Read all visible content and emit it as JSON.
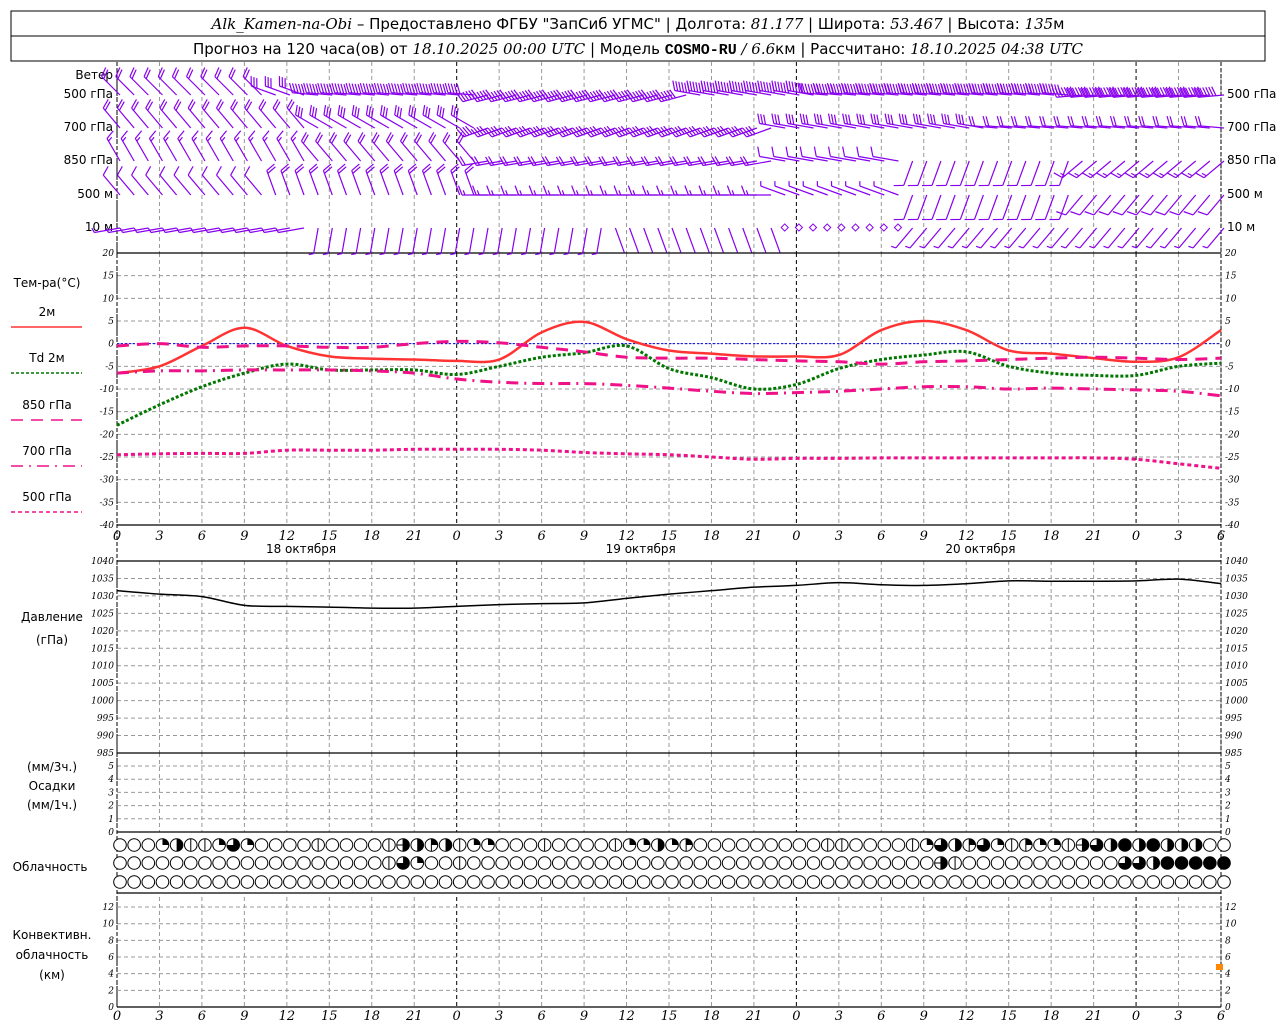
{
  "header": {
    "station": "Alk_Kamen-na-Obi",
    "provider": " – Предоставлено ФГБУ \"ЗапСиб УГМС\" | Долгота: ",
    "lon": "81.177",
    "lat_label": " | Широта: ",
    "lat": "53.467",
    "alt_label": " | Высота: ",
    "alt": "135",
    "alt_unit": "м",
    "forecast_label": "Прогноз на 120 часа(ов) от ",
    "run_time": "18.10.2025 00:00 UTC",
    "model_label": "  | Модель ",
    "model": "COSMO-RU",
    "res": " / 6.6",
    "res_unit": "км",
    "calc_label": " | Рассчитано: ",
    "calc_time": "18.10.2025 04:38 UTC"
  },
  "labels": {
    "wind": "Ветер",
    "wind_levels": [
      "500 гПа",
      "700 гПа",
      "850 гПа",
      "500 м",
      "10 м"
    ],
    "temp_title": "Тем-ра(°С)",
    "temp_legend": [
      "2м",
      "Td  2м",
      "850 гПа",
      "700 гПа",
      "500 гПа"
    ],
    "pressure": [
      "Давление",
      "(гПа)"
    ],
    "precip": [
      "(мм/3ч.)",
      "Осадки",
      "(мм/1ч.)"
    ],
    "clouds": "Облачность",
    "conv": [
      "Конвективн.",
      "облачность",
      "(км)"
    ]
  },
  "colors": {
    "t2m": "#ff3333",
    "td": "#007700",
    "t850": "#ee1188",
    "t700": "#ee1188",
    "t500": "#ee1188",
    "zero": "#0000ff",
    "wind": "#8800ee",
    "conv": "#ff8800"
  },
  "chart_data": {
    "type": "line",
    "x_hours": [
      0,
      3,
      6,
      9,
      12,
      15,
      18,
      21,
      24,
      27,
      30,
      33,
      36,
      39,
      42,
      45,
      48,
      51,
      54,
      57,
      60,
      63,
      66,
      69,
      72,
      75,
      78
    ],
    "hour_labels": [
      "0",
      "3",
      "6",
      "9",
      "12",
      "15",
      "18",
      "21",
      "0",
      "3",
      "6",
      "9",
      "12",
      "15",
      "18",
      "21",
      "0",
      "3",
      "6",
      "9",
      "12",
      "15",
      "18",
      "21",
      "0",
      "3",
      "6"
    ],
    "dates": [
      "18 октября",
      "19 октября",
      "20 октября"
    ],
    "temperature": {
      "ylim": [
        -40,
        20
      ],
      "ticks": [
        20,
        15,
        10,
        5,
        0,
        -5,
        -10,
        -15,
        -20,
        -25,
        -30,
        -35,
        -40
      ],
      "series": [
        {
          "name": "2м",
          "values": [
            -6.5,
            -5,
            -0.5,
            3.5,
            -0.5,
            -2.8,
            -3.3,
            -3.5,
            -3.8,
            -3.5,
            2.5,
            4.8,
            1,
            -1.5,
            -2.2,
            -2.8,
            -2.8,
            -2.5,
            3,
            5,
            3,
            -1.5,
            -2.2,
            -3.2,
            -4,
            -3,
            3
          ]
        },
        {
          "name": "Td  2м",
          "values": [
            -18,
            -13.5,
            -9.5,
            -6.5,
            -4.5,
            -5.8,
            -5.8,
            -5.8,
            -6.8,
            -5,
            -3,
            -2,
            -0.5,
            -5.5,
            -7.5,
            -10,
            -9,
            -5.5,
            -3.5,
            -2.5,
            -1.8,
            -5,
            -6.5,
            -7,
            -7,
            -5,
            -4.3
          ]
        },
        {
          "name": "850 гПа",
          "values": [
            -0.5,
            0,
            -0.8,
            -0.5,
            -0.5,
            -0.8,
            -0.8,
            0,
            0.5,
            0.2,
            -0.8,
            -1.8,
            -3,
            -3.2,
            -3.2,
            -3.5,
            -3.8,
            -4,
            -4.5,
            -4,
            -3.8,
            -3.5,
            -3.2,
            -3,
            -3.2,
            -3.5,
            -3.2
          ]
        },
        {
          "name": "700 гПа",
          "values": [
            -6.5,
            -6,
            -6,
            -5.8,
            -5.8,
            -5.8,
            -6,
            -6.5,
            -7.8,
            -8.5,
            -8.8,
            -8.8,
            -9.2,
            -9.8,
            -10.5,
            -11,
            -10.8,
            -10.5,
            -10,
            -9.5,
            -9.5,
            -10,
            -9.8,
            -10,
            -10.2,
            -10.5,
            -11.5
          ]
        },
        {
          "name": "500 гПа",
          "values": [
            -24.5,
            -24.3,
            -24.2,
            -24.2,
            -23.5,
            -23.5,
            -23.5,
            -23.3,
            -23.3,
            -23.3,
            -23.5,
            -24,
            -24.3,
            -24.5,
            -25,
            -25.5,
            -25.3,
            -25.3,
            -25.2,
            -25.2,
            -25.2,
            -25.2,
            -25.2,
            -25.2,
            -25.5,
            -26.5,
            -27.5
          ]
        }
      ]
    },
    "pressure": {
      "ylim": [
        985,
        1040
      ],
      "ticks": [
        1040,
        1035,
        1030,
        1025,
        1020,
        1015,
        1010,
        1005,
        1000,
        995,
        990,
        985
      ],
      "values": [
        1031.5,
        1030.5,
        1029.8,
        1027.3,
        1027,
        1026.8,
        1026.5,
        1026.5,
        1027,
        1027.5,
        1027.8,
        1028,
        1029.3,
        1030.5,
        1031.5,
        1032.5,
        1033,
        1033.8,
        1033.2,
        1033,
        1033.5,
        1034.3,
        1034.2,
        1034.2,
        1034.3,
        1034.8,
        1033.5
      ]
    },
    "precip": {
      "ylim": [
        0,
        6
      ],
      "ticks": [
        5,
        4,
        3,
        2,
        1,
        0
      ],
      "values": [
        0,
        0,
        0,
        0,
        0,
        0,
        0,
        0,
        0,
        0,
        0,
        0,
        0,
        0,
        0,
        0,
        0,
        0,
        0,
        0,
        0,
        0,
        0,
        0,
        0,
        0,
        0
      ]
    },
    "clouds_okta_hourly": [
      [
        0,
        0,
        0,
        2,
        4,
        1,
        1,
        2,
        6,
        2,
        0,
        0,
        0,
        0,
        1,
        0,
        0,
        0,
        0,
        1,
        5,
        4,
        3,
        4,
        1,
        2,
        2,
        0,
        0,
        0,
        1,
        0,
        0,
        0,
        0,
        1,
        2,
        2,
        4,
        2,
        3,
        0,
        0,
        0,
        0,
        0,
        0,
        0,
        0,
        0,
        1,
        1,
        0,
        0,
        0,
        0,
        1,
        2,
        6,
        4,
        3,
        6,
        2,
        1,
        3,
        2,
        2,
        1,
        5,
        6,
        4,
        8,
        4,
        8,
        4,
        4,
        4,
        0,
        0
      ],
      [
        0,
        0,
        0,
        0,
        0,
        0,
        0,
        0,
        0,
        0,
        0,
        0,
        0,
        0,
        0,
        0,
        0,
        0,
        0,
        1,
        6,
        2,
        0,
        0,
        1,
        0,
        0,
        0,
        0,
        0,
        0,
        0,
        0,
        0,
        0,
        0,
        0,
        0,
        0,
        0,
        0,
        0,
        0,
        0,
        0,
        0,
        0,
        0,
        0,
        0,
        0,
        0,
        0,
        0,
        0,
        0,
        0,
        0,
        5,
        1,
        0,
        0,
        0,
        0,
        0,
        0,
        0,
        0,
        0,
        0,
        0,
        6,
        6,
        4,
        8,
        8,
        8,
        8,
        8
      ],
      [
        0,
        0,
        0,
        0,
        0,
        0,
        0,
        0,
        0,
        0,
        0,
        0,
        0,
        0,
        0,
        0,
        0,
        0,
        0,
        0,
        0,
        0,
        0,
        0,
        0,
        0,
        0,
        0,
        0,
        0,
        0,
        0,
        0,
        0,
        0,
        0,
        0,
        0,
        0,
        0,
        0,
        0,
        0,
        0,
        0,
        0,
        0,
        0,
        0,
        0,
        0,
        0,
        0,
        0,
        0,
        0,
        0,
        0,
        0,
        0,
        0,
        0,
        0,
        0,
        0,
        0,
        0,
        0,
        0,
        0,
        0,
        0,
        0,
        0,
        0,
        0,
        0,
        0,
        0
      ]
    ],
    "convective_cloud": {
      "ylim": [
        0,
        13
      ],
      "ticks": [
        12,
        10,
        8,
        6,
        4,
        2,
        0
      ],
      "points": [
        {
          "hour": 78,
          "km": 4.8
        }
      ]
    },
    "wind": {
      "units": "m/s",
      "levels": [
        {
          "dir": [
            315,
            315,
            315,
            315,
            290,
            275,
            275,
            275,
            275,
            255,
            255,
            255,
            255,
            255,
            280,
            280,
            280,
            275,
            275,
            275,
            275,
            275,
            275,
            265,
            265,
            265,
            265
          ],
          "speed": [
            10,
            10,
            10,
            10,
            15,
            25,
            25,
            25,
            25,
            30,
            30,
            30,
            30,
            30,
            30,
            30,
            30,
            35,
            35,
            35,
            35,
            35,
            35,
            35,
            35,
            35,
            35
          ]
        },
        {
          "dir": [
            320,
            320,
            320,
            320,
            320,
            300,
            300,
            300,
            300,
            250,
            250,
            250,
            250,
            250,
            250,
            250,
            280,
            280,
            280,
            280,
            280,
            275,
            275,
            275,
            275,
            275,
            275
          ],
          "speed": [
            10,
            10,
            10,
            10,
            10,
            15,
            15,
            15,
            15,
            20,
            20,
            20,
            20,
            20,
            20,
            20,
            15,
            15,
            15,
            15,
            15,
            12,
            12,
            12,
            12,
            12,
            12
          ]
        },
        {
          "dir": [
            330,
            330,
            330,
            330,
            330,
            320,
            320,
            320,
            320,
            260,
            260,
            260,
            260,
            260,
            260,
            260,
            280,
            280,
            280,
            200,
            200,
            200,
            200,
            230,
            230,
            230,
            230
          ],
          "speed": [
            8,
            8,
            8,
            8,
            8,
            12,
            12,
            12,
            12,
            12,
            12,
            12,
            12,
            12,
            12,
            12,
            5,
            5,
            5,
            6,
            6,
            6,
            6,
            8,
            8,
            8,
            8
          ]
        },
        {
          "dir": [
            320,
            320,
            320,
            320,
            340,
            340,
            340,
            340,
            340,
            270,
            270,
            270,
            270,
            270,
            270,
            270,
            290,
            290,
            290,
            200,
            200,
            200,
            200,
            220,
            220,
            220,
            220
          ],
          "speed": [
            6,
            6,
            6,
            6,
            10,
            10,
            10,
            10,
            10,
            8,
            8,
            8,
            8,
            8,
            8,
            8,
            3,
            3,
            3,
            5,
            5,
            5,
            5,
            6,
            6,
            6,
            6
          ]
        },
        {
          "dir": [
            260,
            260,
            260,
            260,
            260,
            190,
            190,
            190,
            190,
            190,
            190,
            190,
            160,
            160,
            160,
            160,
            0,
            0,
            0,
            220,
            220,
            220,
            220,
            220,
            220,
            220,
            220
          ],
          "speed": [
            4,
            4,
            4,
            4,
            4,
            3,
            3,
            3,
            3,
            3,
            3,
            3,
            2,
            2,
            2,
            2,
            0,
            0,
            0,
            3,
            3,
            3,
            3,
            3,
            3,
            3,
            3
          ]
        }
      ]
    }
  }
}
